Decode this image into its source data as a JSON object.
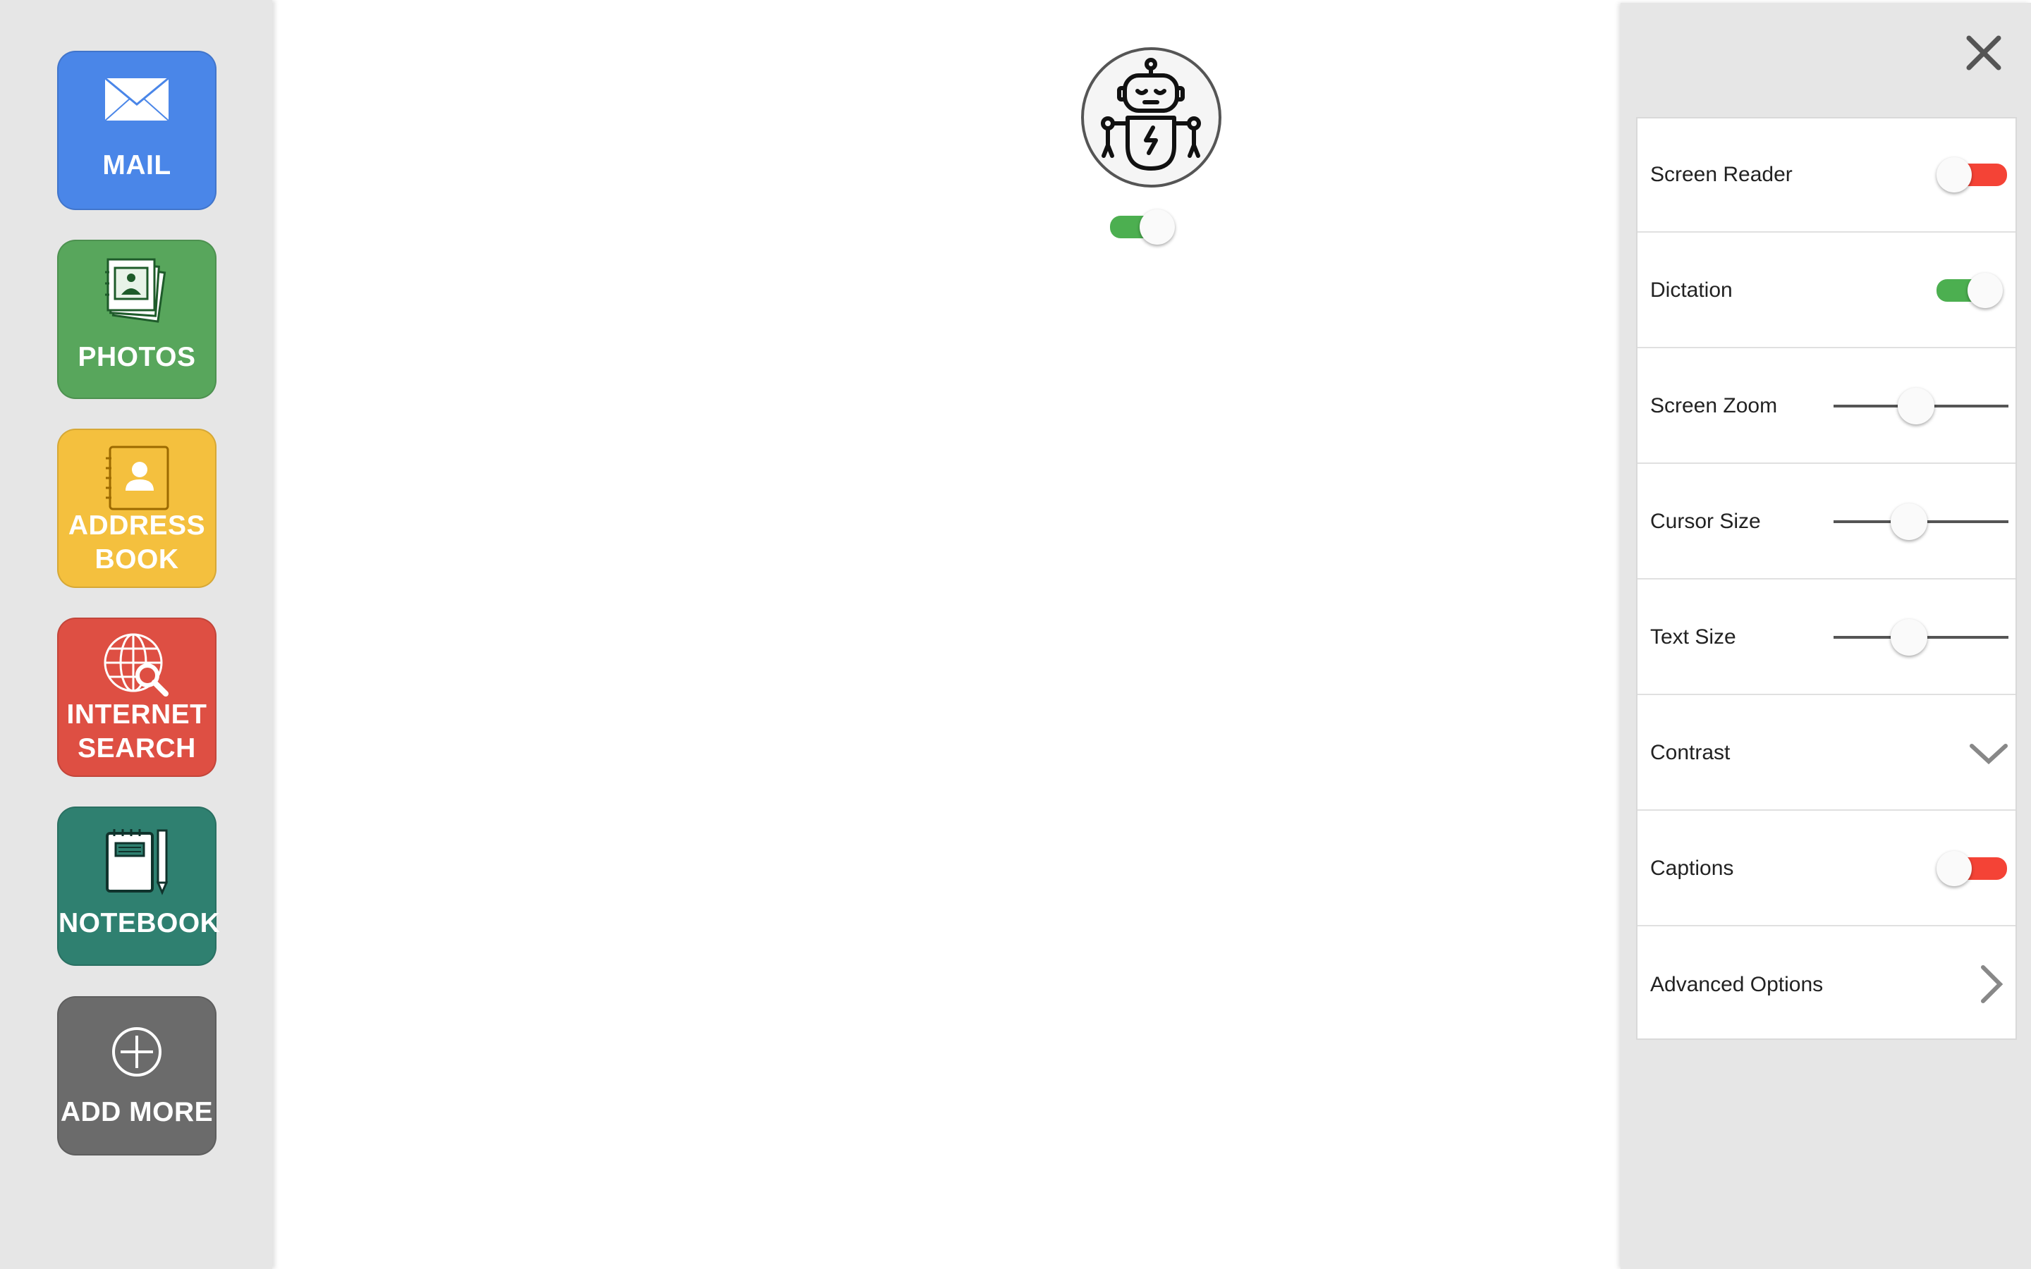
{
  "colors": {
    "mail": "#4a86e8",
    "photos": "#58a65c",
    "address_book": "#f4c03e",
    "internet_search": "#de4f43",
    "notebook": "#2f8070",
    "add_more": "#6b6b6b",
    "toggle_on": "#4caf50",
    "toggle_off": "#f44336"
  },
  "sidebar": {
    "apps": [
      {
        "label": "MAIL",
        "icon": "mail-icon"
      },
      {
        "label": "PHOTOS",
        "icon": "photos-icon"
      },
      {
        "label": "ADDRESS\nBOOK",
        "icon": "address-book-icon"
      },
      {
        "label": "INTERNET\nSEARCH",
        "icon": "globe-search-icon"
      },
      {
        "label": "NOTEBOOK",
        "icon": "notebook-pencil-icon"
      },
      {
        "label": "ADD MORE",
        "icon": "plus-circle-icon"
      }
    ]
  },
  "assistant": {
    "avatar_icon": "robot-icon",
    "enabled": true
  },
  "settings": {
    "close_icon": "close-icon",
    "items": [
      {
        "label": "Screen Reader",
        "control": "toggle",
        "on": false
      },
      {
        "label": "Dictation",
        "control": "toggle",
        "on": true
      },
      {
        "label": "Screen Zoom",
        "control": "slider",
        "value": 0.47
      },
      {
        "label": "Cursor Size",
        "control": "slider",
        "value": 0.43
      },
      {
        "label": "Text Size",
        "control": "slider",
        "value": 0.43
      },
      {
        "label": "Contrast",
        "control": "dropdown",
        "icon": "chevron-down-icon"
      },
      {
        "label": "Captions",
        "control": "toggle",
        "on": false
      },
      {
        "label": "Advanced Options",
        "control": "link",
        "icon": "chevron-right-icon"
      }
    ]
  }
}
